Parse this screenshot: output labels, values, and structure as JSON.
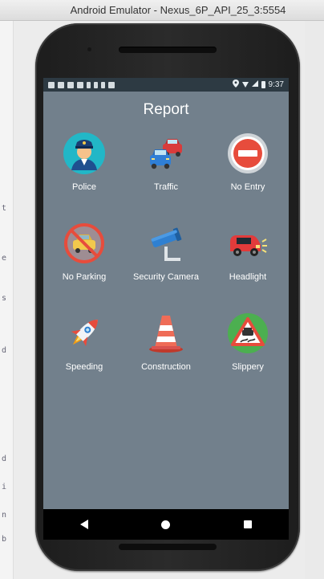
{
  "window": {
    "title": "Android Emulator - Nexus_6P_API_25_3:5554"
  },
  "left_strip_glyphs": [
    "t",
    "e",
    "s",
    "d",
    "d",
    "i",
    "n",
    "b"
  ],
  "status_bar": {
    "time": "9:37"
  },
  "app": {
    "title": "Report"
  },
  "grid_items": [
    {
      "label": "Police",
      "icon": "police-officer-icon"
    },
    {
      "label": "Traffic",
      "icon": "traffic-cars-icon"
    },
    {
      "label": "No Entry",
      "icon": "no-entry-sign-icon"
    },
    {
      "label": "No Parking",
      "icon": "no-parking-sign-icon"
    },
    {
      "label": "Security Camera",
      "icon": "security-camera-icon"
    },
    {
      "label": "Headlight",
      "icon": "headlight-car-icon"
    },
    {
      "label": "Speeding",
      "icon": "rocket-icon"
    },
    {
      "label": "Construction",
      "icon": "traffic-cone-icon"
    },
    {
      "label": "Slippery",
      "icon": "slippery-road-sign-icon"
    }
  ],
  "colors": {
    "screen_bg": "#72808c",
    "status_bar": "#2d3a43",
    "nav_bar": "#000000",
    "text": "#ffffff"
  }
}
